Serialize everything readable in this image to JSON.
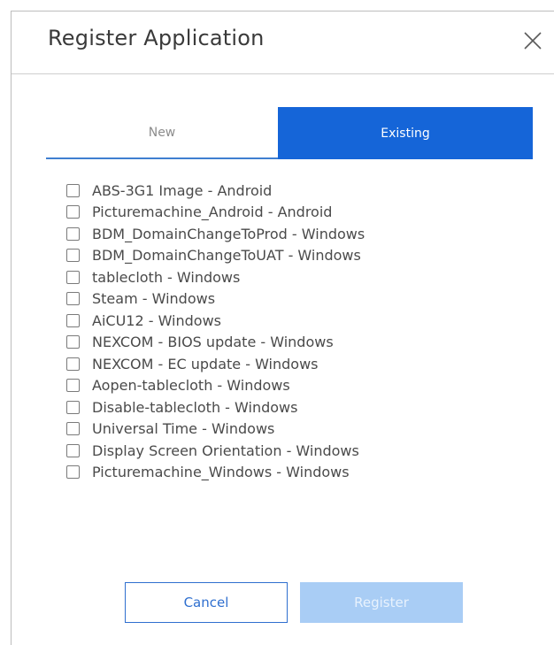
{
  "dialog": {
    "title": "Register Application",
    "close_icon": "close-icon"
  },
  "tabs": [
    {
      "label": "New",
      "active": false
    },
    {
      "label": "Existing",
      "active": true
    }
  ],
  "applications": [
    {
      "label": "ABS-3G1 Image - Android",
      "checked": false
    },
    {
      "label": "Picturemachine_Android - Android",
      "checked": false
    },
    {
      "label": "BDM_DomainChangeToProd - Windows",
      "checked": false
    },
    {
      "label": "BDM_DomainChangeToUAT - Windows",
      "checked": false
    },
    {
      "label": "tablecloth - Windows",
      "checked": false
    },
    {
      "label": "Steam - Windows",
      "checked": false
    },
    {
      "label": "AiCU12 - Windows",
      "checked": false
    },
    {
      "label": "NEXCOM - BIOS update - Windows",
      "checked": false
    },
    {
      "label": "NEXCOM - EC update - Windows",
      "checked": false
    },
    {
      "label": "Aopen-tablecloth - Windows",
      "checked": false
    },
    {
      "label": "Disable-tablecloth - Windows",
      "checked": false
    },
    {
      "label": "Universal Time - Windows",
      "checked": false
    },
    {
      "label": "Display Screen Orientation - Windows",
      "checked": false
    },
    {
      "label": "Picturemachine_Windows - Windows",
      "checked": false
    }
  ],
  "actions": {
    "cancel_label": "Cancel",
    "register_label": "Register",
    "register_enabled": false
  },
  "colors": {
    "accent": "#1565d8",
    "register_disabled_bg": "#a9cdf5"
  }
}
